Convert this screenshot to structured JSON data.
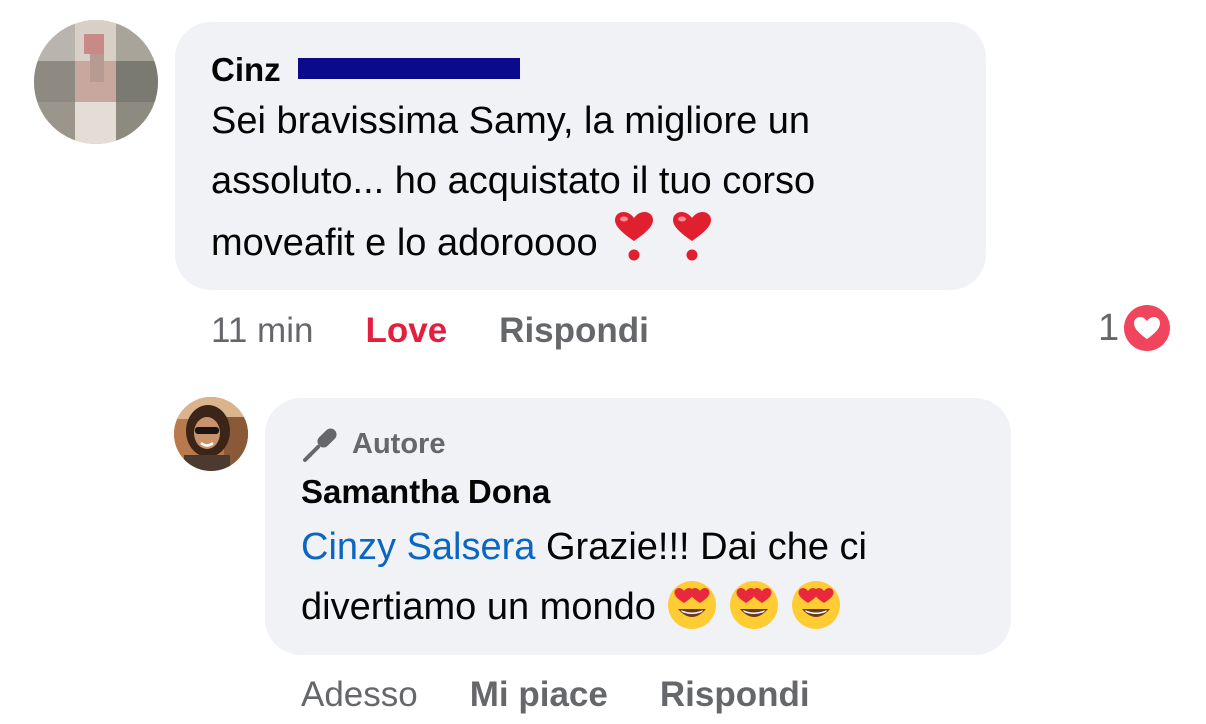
{
  "comment": {
    "author": "Cinzy Salsera",
    "author_visible": "Cinz",
    "text_lines": [
      "Sei bravissima Samy, la migliore un",
      "assoluto... ho acquistato il tuo corso",
      "moveafit e lo adoroooo"
    ],
    "trailing_emoji": "heavy-heart-exclamation",
    "time": "11 min",
    "reaction_label": "Love",
    "reply_label": "Rispondi",
    "reaction_count": "1",
    "reaction_type": "heart",
    "colors": {
      "love": "#e41e3f",
      "bubble": "#f0f2f5",
      "meta": "#65676b",
      "redaction": "#0a0a8c"
    }
  },
  "reply": {
    "badge": "Autore",
    "badge_icon": "microphone-icon",
    "author": "Samantha Dona",
    "mention": "Cinzy Salsera",
    "text_line1_rest": " Grazie!!! Dai che ci",
    "text_line2": "divertiamo un mondo",
    "trailing_emoji": "heart-eyes-smiley",
    "time": "Adesso",
    "like_label": "Mi piace",
    "reply_label": "Rispondi",
    "colors": {
      "mention": "#0a66c2"
    }
  }
}
